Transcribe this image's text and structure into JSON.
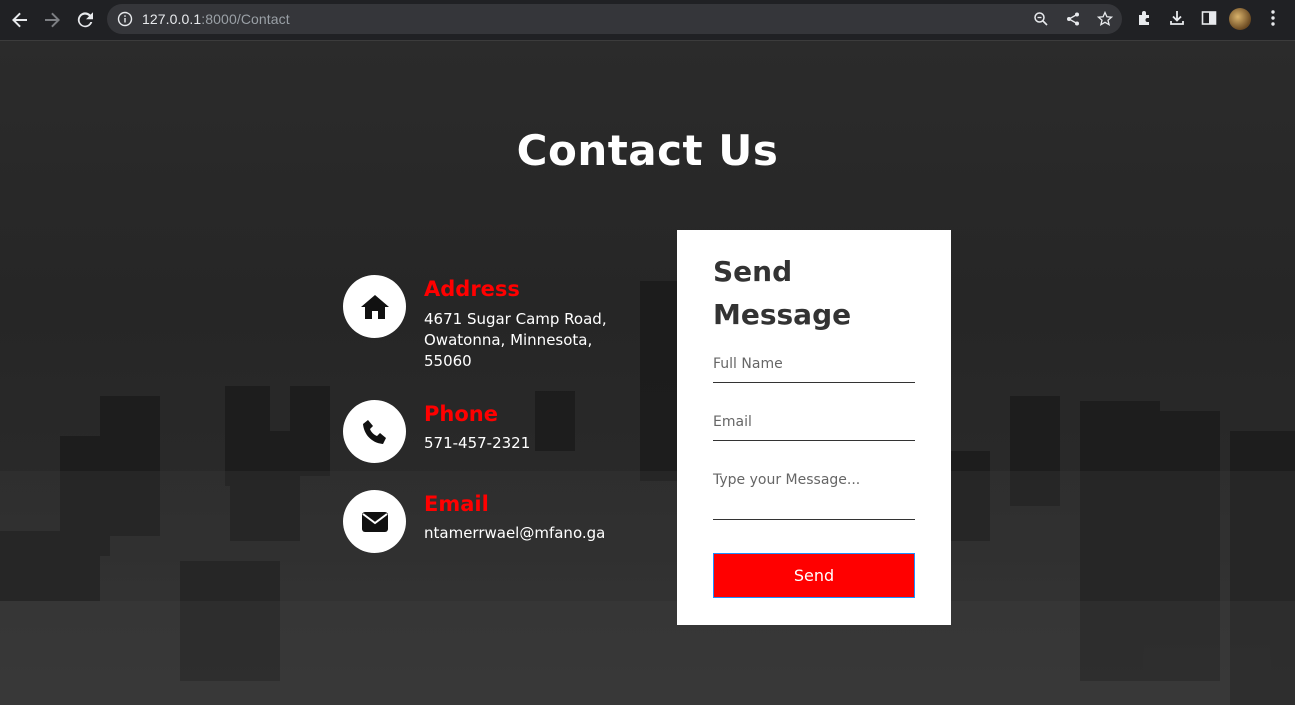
{
  "browser": {
    "url_host": "127.0.0.1",
    "url_path": ":8000/Contact"
  },
  "page": {
    "title": "Contact Us",
    "contact": [
      {
        "label": "Address",
        "text": "4671 Sugar Camp Road, Owatonna, Minnesota, 55060",
        "icon": "home-icon"
      },
      {
        "label": "Phone",
        "text": "571-457-2321",
        "icon": "phone-icon"
      },
      {
        "label": "Email",
        "text": "ntamerrwael@mfano.ga",
        "icon": "envelope-icon"
      }
    ],
    "form": {
      "heading": "Send Message",
      "full_name_placeholder": "Full Name",
      "email_placeholder": "Email",
      "message_placeholder": "Type your Message...",
      "send_label": "Send"
    }
  },
  "colors": {
    "accent": "#ff0000",
    "background": "#262626",
    "chrome": "#202124"
  }
}
